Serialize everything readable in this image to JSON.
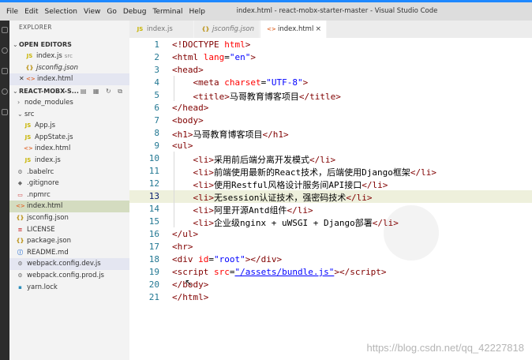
{
  "window": {
    "menu": [
      "File",
      "Edit",
      "Selection",
      "View",
      "Go",
      "Debug",
      "Terminal",
      "Help"
    ],
    "title": "index.html - react-mobx-starter-master - Visual Studio Code"
  },
  "sidebar": {
    "title": "EXPLORER",
    "open_editors_label": "OPEN EDITORS",
    "open_editors": [
      {
        "name": "index.js",
        "sub": "src",
        "icon": "JS"
      },
      {
        "name": "jsconfig.json",
        "sub": "",
        "icon": "{}"
      },
      {
        "name": "index.html",
        "sub": "",
        "icon": "<>"
      }
    ],
    "project_label": "REACT-MOBX-S...",
    "tree": [
      {
        "name": "node_modules",
        "icon": "›",
        "kind": "folder"
      },
      {
        "name": "src",
        "icon": "⌄",
        "kind": "folder"
      },
      {
        "name": "App.js",
        "icon": "JS",
        "kind": "js"
      },
      {
        "name": "AppState.js",
        "icon": "JS",
        "kind": "js"
      },
      {
        "name": "index.html",
        "icon": "<>",
        "kind": "html"
      },
      {
        "name": "index.js",
        "icon": "JS",
        "kind": "js"
      },
      {
        "name": ".babelrc",
        "icon": "⚙",
        "kind": "gen"
      },
      {
        "name": ".gitignore",
        "icon": "◆",
        "kind": "gen"
      },
      {
        "name": ".npmrc",
        "icon": "▭",
        "kind": "gen"
      },
      {
        "name": "index.html",
        "icon": "<>",
        "kind": "html"
      },
      {
        "name": "jsconfig.json",
        "icon": "{}",
        "kind": "json"
      },
      {
        "name": "LICENSE",
        "icon": "≡",
        "kind": "gen"
      },
      {
        "name": "package.json",
        "icon": "{}",
        "kind": "json"
      },
      {
        "name": "README.md",
        "icon": "ⓘ",
        "kind": "gen"
      },
      {
        "name": "webpack.config.dev.js",
        "icon": "⚙",
        "kind": "gen"
      },
      {
        "name": "webpack.config.prod.js",
        "icon": "⚙",
        "kind": "gen"
      },
      {
        "name": "yarn.lock",
        "icon": "▪",
        "kind": "gen"
      }
    ]
  },
  "tabs": [
    {
      "label": "index.js",
      "icon": "JS"
    },
    {
      "label": "jsconfig.json",
      "icon": "{}"
    },
    {
      "label": "index.html",
      "icon": "<>",
      "close": "×"
    }
  ],
  "editor": {
    "line_numbers": [
      "1",
      "2",
      "3",
      "4",
      "5",
      "6",
      "7",
      "8",
      "9",
      "10",
      "11",
      "12",
      "13",
      "14",
      "15",
      "16",
      "17",
      "18",
      "19",
      "20",
      "21"
    ],
    "current_line": 13
  },
  "watermark": "https://blog.csdn.net/qq_42227818"
}
